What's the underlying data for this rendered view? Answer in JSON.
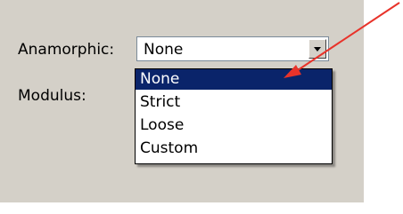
{
  "form": {
    "anamorphic_label": "Anamorphic:",
    "anamorphic_value": "None",
    "modulus_label": "Modulus:"
  },
  "dropdown": {
    "options": [
      "None",
      "Strict",
      "Loose",
      "Custom"
    ],
    "selected_option": "None",
    "open": true
  },
  "annotation": {
    "arrow_color": "#e8332a"
  },
  "colors": {
    "panel_background": "#d4d0c8",
    "selection_highlight": "#0a246a"
  }
}
